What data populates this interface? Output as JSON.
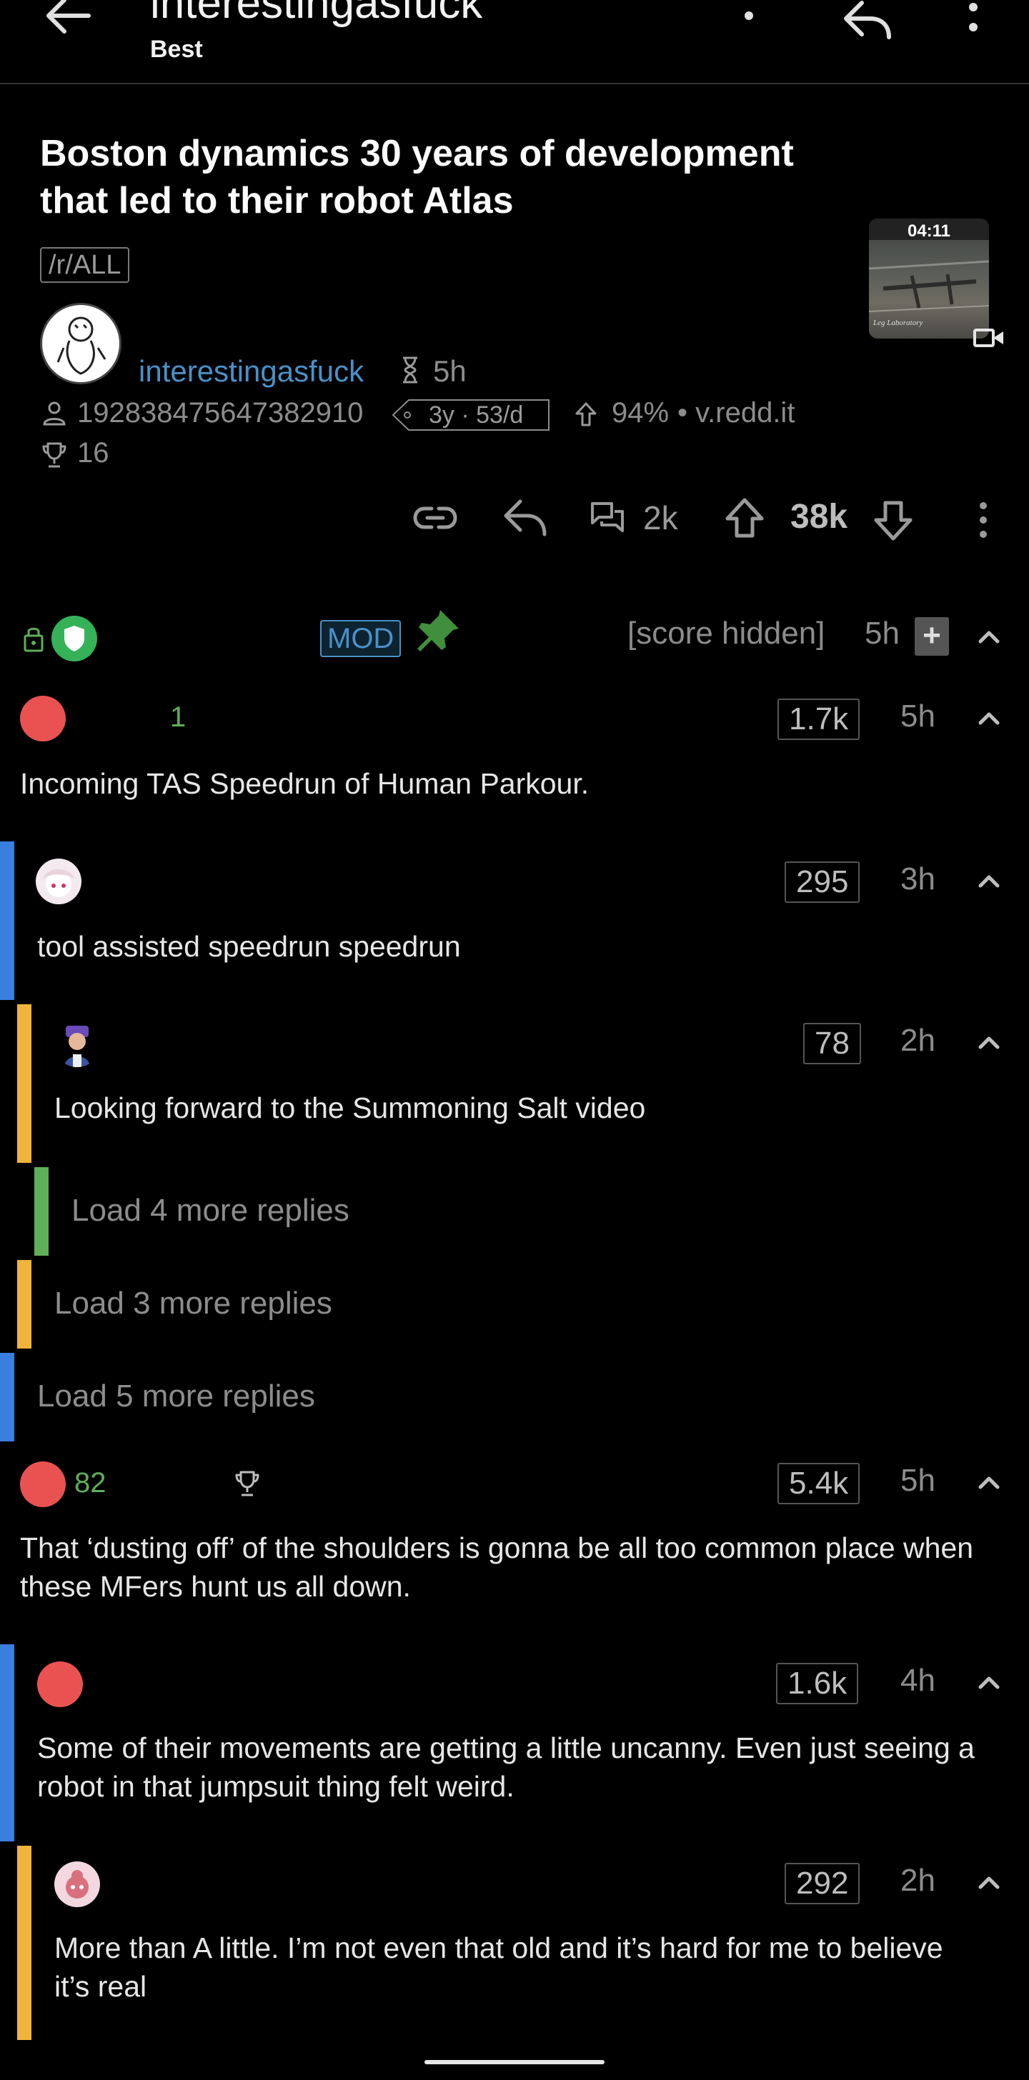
{
  "header": {
    "title": "interestingasfuck",
    "subtitle": "Best"
  },
  "post": {
    "title": "Boston dynamics 30 years of development that led to their robot Atlas",
    "flair": "/r/ALL",
    "subreddit": "interestingasfuck",
    "age": "5h",
    "author_line": "192838475647382910",
    "account_badge": "3y · 53/d",
    "upvote_ratio": "94%",
    "domain": "• v.redd.it",
    "awards": "16",
    "thumbnail_duration": "04:11",
    "comments_count": "2k",
    "score": "38k",
    "thumb_caption": "Leg Laboratory"
  },
  "mod_comment": {
    "badge": "MOD",
    "score": "[score hidden]",
    "age": "5h",
    "expand_label": "+"
  },
  "comments": [
    {
      "user_suffix": "1",
      "score": "1.7k",
      "age": "5h",
      "text": "Incoming TAS Speedrun of Human Parkour."
    },
    {
      "score": "295",
      "age": "3h",
      "text": "tool assisted speedrun speedrun"
    },
    {
      "score": "78",
      "age": "2h",
      "text": "Looking forward to the Summoning Salt video"
    },
    {
      "user_suffix": "82",
      "score": "5.4k",
      "age": "5h",
      "text": "That ‘dusting off’ of the shoulders is gonna be all too common place when these MFers hunt us all down."
    },
    {
      "score": "1.6k",
      "age": "4h",
      "text": "Some of their movements are getting a little uncanny. Even just seeing a robot in that jumpsuit thing felt weird."
    },
    {
      "score": "292",
      "age": "2h",
      "text": "More than A little. I’m not even that old and it’s hard for me to believe it’s real"
    }
  ],
  "load_more": [
    "Load 4 more replies",
    "Load 3 more replies",
    "Load 5 more replies"
  ],
  "colors": {
    "blue": "#3a7ee0",
    "yellow": "#f0b43c",
    "green": "#5fae58",
    "link": "#4a90c8",
    "avatar_red": "#ea5252"
  }
}
